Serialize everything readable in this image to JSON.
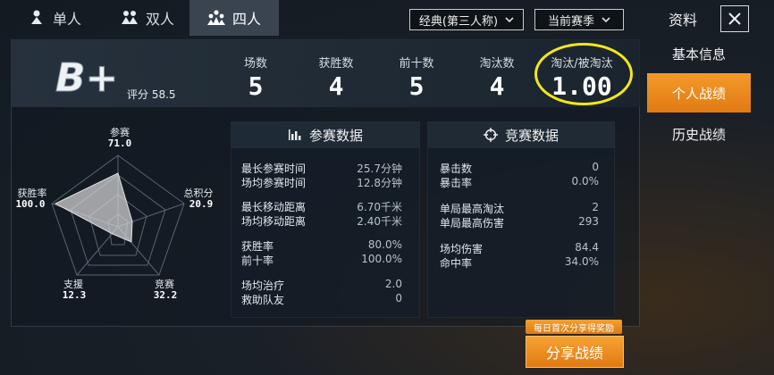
{
  "tabs": [
    {
      "label": "单人",
      "icon": "solo-person-icon"
    },
    {
      "label": "双人",
      "icon": "duo-person-icon"
    },
    {
      "label": "四人",
      "icon": "squad-person-icon"
    }
  ],
  "active_tab": 2,
  "dropdowns": {
    "mode": "经典(第三人称)",
    "season": "当前赛季"
  },
  "side": {
    "title": "资料",
    "items": [
      "基本信息",
      "个人战绩",
      "历史战绩"
    ],
    "active_index": 1
  },
  "grade": {
    "letter": "B+",
    "rating_label": "评分",
    "rating_value": "58.5"
  },
  "stats": [
    {
      "label": "场数",
      "value": "5"
    },
    {
      "label": "获胜数",
      "value": "4"
    },
    {
      "label": "前十数",
      "value": "5"
    },
    {
      "label": "淘汰数",
      "value": "4"
    },
    {
      "label": "淘汰/被淘汰",
      "value": "1.00"
    }
  ],
  "radar": {
    "axes": [
      {
        "label": "参赛",
        "value": "71.0"
      },
      {
        "label": "总积分",
        "value": "20.9"
      },
      {
        "label": "竞赛",
        "value": "32.2"
      },
      {
        "label": "支援",
        "value": "12.3"
      },
      {
        "label": "获胜率",
        "value": "100.0"
      }
    ]
  },
  "participation": {
    "title": "参赛数据",
    "groups": [
      [
        {
          "label": "最长参赛时间",
          "value": "25.7分钟"
        },
        {
          "label": "场均参赛时间",
          "value": "12.8分钟"
        }
      ],
      [
        {
          "label": "最长移动距离",
          "value": "6.70千米"
        },
        {
          "label": "场均移动距离",
          "value": "2.40千米"
        }
      ],
      [
        {
          "label": "获胜率",
          "value": "80.0%"
        },
        {
          "label": "前十率",
          "value": "100.0%"
        }
      ],
      [
        {
          "label": "场均治疗",
          "value": "2.0"
        },
        {
          "label": "救助队友",
          "value": "0"
        }
      ]
    ]
  },
  "competition": {
    "title": "竞赛数据",
    "groups": [
      [
        {
          "label": "暴击数",
          "value": "0"
        },
        {
          "label": "暴击率",
          "value": "0.0%"
        }
      ],
      [
        {
          "label": "单局最高淘汰",
          "value": "2"
        },
        {
          "label": "单局最高伤害",
          "value": "293"
        }
      ],
      [
        {
          "label": "场均伤害",
          "value": "84.4"
        },
        {
          "label": "命中率",
          "value": "34.0%"
        }
      ]
    ]
  },
  "share": {
    "banner": "每日首次分享得奖励",
    "button": "分享战绩"
  }
}
